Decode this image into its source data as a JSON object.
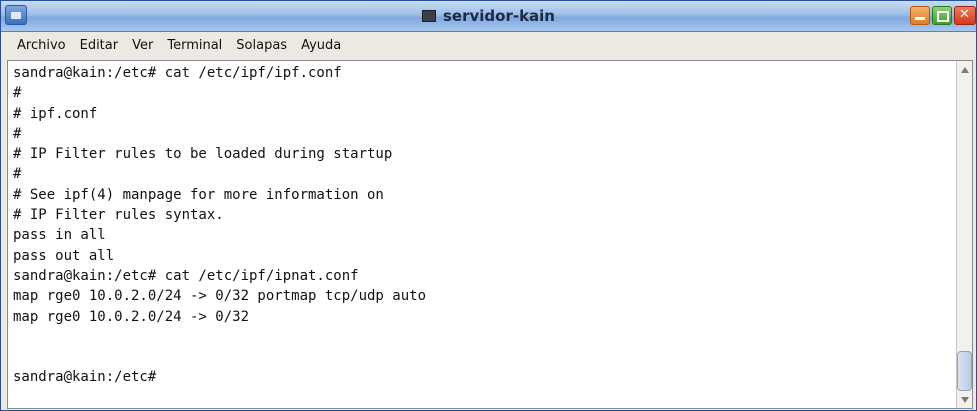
{
  "window": {
    "title": "servidor-kain"
  },
  "menubar": {
    "items": [
      {
        "label": "Archivo"
      },
      {
        "label": "Editar"
      },
      {
        "label": "Ver"
      },
      {
        "label": "Terminal"
      },
      {
        "label": "Solapas"
      },
      {
        "label": "Ayuda"
      }
    ]
  },
  "terminal": {
    "lines": [
      "sandra@kain:/etc# cat /etc/ipf/ipf.conf",
      "#",
      "# ipf.conf",
      "#",
      "# IP Filter rules to be loaded during startup",
      "#",
      "# See ipf(4) manpage for more information on",
      "# IP Filter rules syntax.",
      "pass in all",
      "pass out all",
      "sandra@kain:/etc# cat /etc/ipf/ipnat.conf",
      "map rge0 10.0.2.0/24 -> 0/32 portmap tcp/udp auto",
      "map rge0 10.0.2.0/24 -> 0/32",
      "",
      "",
      "sandra@kain:/etc#"
    ]
  },
  "icons": {
    "window_menu": "window-menu-icon",
    "terminal_title": "terminal-icon",
    "minimize": "minimize-icon",
    "maximize": "maximize-icon",
    "close": "close-icon",
    "scroll_up": "scroll-up-arrow-icon",
    "scroll_down": "scroll-down-arrow-icon"
  },
  "colors": {
    "titlebar": "#9cbfe8",
    "terminal_bg": "#ffffff",
    "terminal_fg": "#111111",
    "minimize": "#e07c22",
    "maximize": "#3e9e2c",
    "close": "#d23a1a"
  }
}
